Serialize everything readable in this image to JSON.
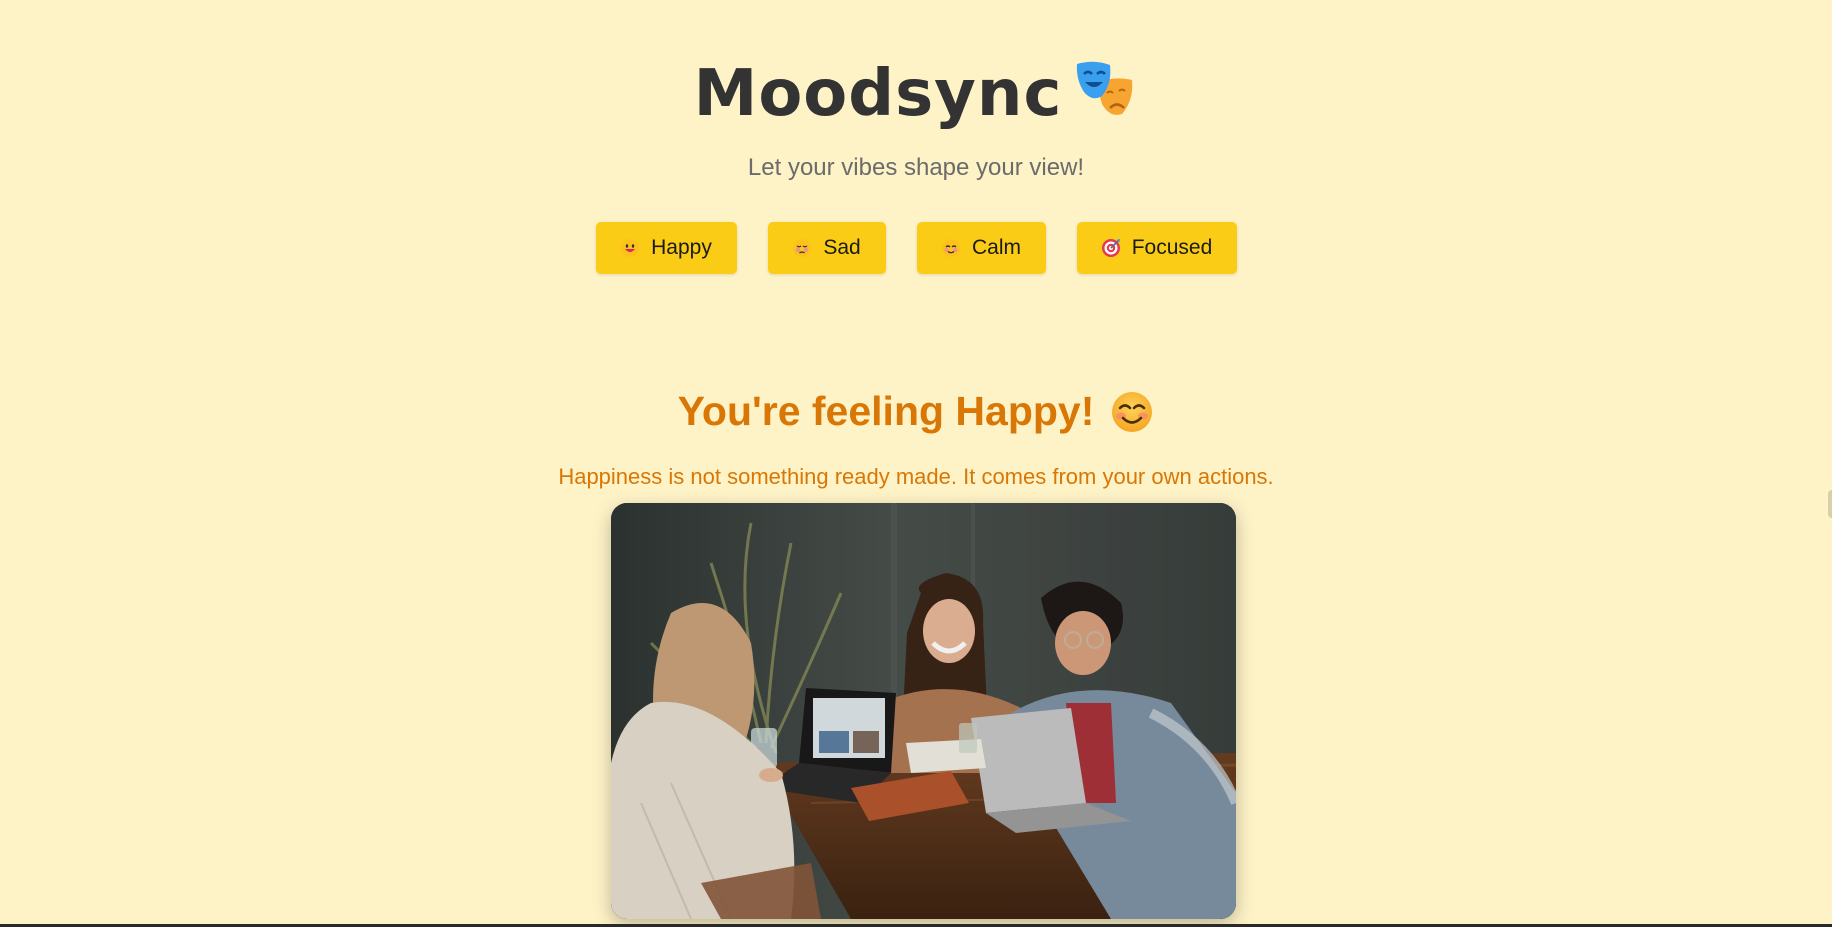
{
  "header": {
    "title": "Moodsync",
    "title_icon": "theater-masks-icon",
    "subtitle": "Let your vibes shape your view!"
  },
  "moods": [
    {
      "label": "Happy",
      "icon": "grinning-face-icon"
    },
    {
      "label": "Sad",
      "icon": "sad-face-icon"
    },
    {
      "label": "Calm",
      "icon": "relieved-face-icon"
    },
    {
      "label": "Focused",
      "icon": "target-icon"
    }
  ],
  "current": {
    "heading": "You're feeling Happy!",
    "heading_icon": "smiling-face-icon",
    "quote": "Happiness is not something ready made. It comes from your own actions.",
    "photo_icon": "friends-laughing-at-table-photo"
  },
  "colors": {
    "background": "#fef3c7",
    "button": "#facc15",
    "accent": "#d97706",
    "title": "#333333",
    "subtitle": "#6b6b6b"
  }
}
